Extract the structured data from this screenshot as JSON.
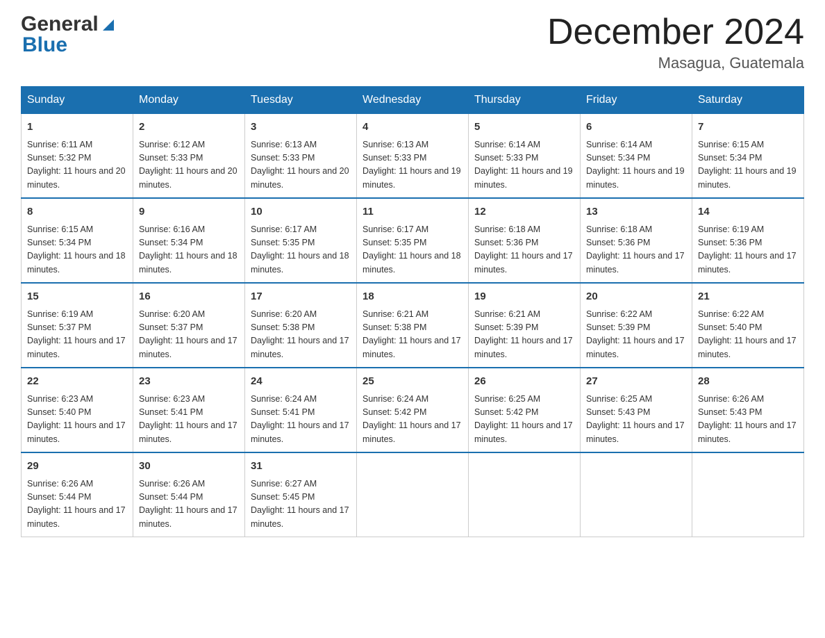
{
  "header": {
    "logo_general": "General",
    "logo_blue": "Blue",
    "month_title": "December 2024",
    "location": "Masagua, Guatemala"
  },
  "weekdays": [
    "Sunday",
    "Monday",
    "Tuesday",
    "Wednesday",
    "Thursday",
    "Friday",
    "Saturday"
  ],
  "weeks": [
    [
      {
        "day": "1",
        "sunrise": "6:11 AM",
        "sunset": "5:32 PM",
        "daylight": "11 hours and 20 minutes."
      },
      {
        "day": "2",
        "sunrise": "6:12 AM",
        "sunset": "5:33 PM",
        "daylight": "11 hours and 20 minutes."
      },
      {
        "day": "3",
        "sunrise": "6:13 AM",
        "sunset": "5:33 PM",
        "daylight": "11 hours and 20 minutes."
      },
      {
        "day": "4",
        "sunrise": "6:13 AM",
        "sunset": "5:33 PM",
        "daylight": "11 hours and 19 minutes."
      },
      {
        "day": "5",
        "sunrise": "6:14 AM",
        "sunset": "5:33 PM",
        "daylight": "11 hours and 19 minutes."
      },
      {
        "day": "6",
        "sunrise": "6:14 AM",
        "sunset": "5:34 PM",
        "daylight": "11 hours and 19 minutes."
      },
      {
        "day": "7",
        "sunrise": "6:15 AM",
        "sunset": "5:34 PM",
        "daylight": "11 hours and 19 minutes."
      }
    ],
    [
      {
        "day": "8",
        "sunrise": "6:15 AM",
        "sunset": "5:34 PM",
        "daylight": "11 hours and 18 minutes."
      },
      {
        "day": "9",
        "sunrise": "6:16 AM",
        "sunset": "5:34 PM",
        "daylight": "11 hours and 18 minutes."
      },
      {
        "day": "10",
        "sunrise": "6:17 AM",
        "sunset": "5:35 PM",
        "daylight": "11 hours and 18 minutes."
      },
      {
        "day": "11",
        "sunrise": "6:17 AM",
        "sunset": "5:35 PM",
        "daylight": "11 hours and 18 minutes."
      },
      {
        "day": "12",
        "sunrise": "6:18 AM",
        "sunset": "5:36 PM",
        "daylight": "11 hours and 17 minutes."
      },
      {
        "day": "13",
        "sunrise": "6:18 AM",
        "sunset": "5:36 PM",
        "daylight": "11 hours and 17 minutes."
      },
      {
        "day": "14",
        "sunrise": "6:19 AM",
        "sunset": "5:36 PM",
        "daylight": "11 hours and 17 minutes."
      }
    ],
    [
      {
        "day": "15",
        "sunrise": "6:19 AM",
        "sunset": "5:37 PM",
        "daylight": "11 hours and 17 minutes."
      },
      {
        "day": "16",
        "sunrise": "6:20 AM",
        "sunset": "5:37 PM",
        "daylight": "11 hours and 17 minutes."
      },
      {
        "day": "17",
        "sunrise": "6:20 AM",
        "sunset": "5:38 PM",
        "daylight": "11 hours and 17 minutes."
      },
      {
        "day": "18",
        "sunrise": "6:21 AM",
        "sunset": "5:38 PM",
        "daylight": "11 hours and 17 minutes."
      },
      {
        "day": "19",
        "sunrise": "6:21 AM",
        "sunset": "5:39 PM",
        "daylight": "11 hours and 17 minutes."
      },
      {
        "day": "20",
        "sunrise": "6:22 AM",
        "sunset": "5:39 PM",
        "daylight": "11 hours and 17 minutes."
      },
      {
        "day": "21",
        "sunrise": "6:22 AM",
        "sunset": "5:40 PM",
        "daylight": "11 hours and 17 minutes."
      }
    ],
    [
      {
        "day": "22",
        "sunrise": "6:23 AM",
        "sunset": "5:40 PM",
        "daylight": "11 hours and 17 minutes."
      },
      {
        "day": "23",
        "sunrise": "6:23 AM",
        "sunset": "5:41 PM",
        "daylight": "11 hours and 17 minutes."
      },
      {
        "day": "24",
        "sunrise": "6:24 AM",
        "sunset": "5:41 PM",
        "daylight": "11 hours and 17 minutes."
      },
      {
        "day": "25",
        "sunrise": "6:24 AM",
        "sunset": "5:42 PM",
        "daylight": "11 hours and 17 minutes."
      },
      {
        "day": "26",
        "sunrise": "6:25 AM",
        "sunset": "5:42 PM",
        "daylight": "11 hours and 17 minutes."
      },
      {
        "day": "27",
        "sunrise": "6:25 AM",
        "sunset": "5:43 PM",
        "daylight": "11 hours and 17 minutes."
      },
      {
        "day": "28",
        "sunrise": "6:26 AM",
        "sunset": "5:43 PM",
        "daylight": "11 hours and 17 minutes."
      }
    ],
    [
      {
        "day": "29",
        "sunrise": "6:26 AM",
        "sunset": "5:44 PM",
        "daylight": "11 hours and 17 minutes."
      },
      {
        "day": "30",
        "sunrise": "6:26 AM",
        "sunset": "5:44 PM",
        "daylight": "11 hours and 17 minutes."
      },
      {
        "day": "31",
        "sunrise": "6:27 AM",
        "sunset": "5:45 PM",
        "daylight": "11 hours and 17 minutes."
      },
      null,
      null,
      null,
      null
    ]
  ]
}
